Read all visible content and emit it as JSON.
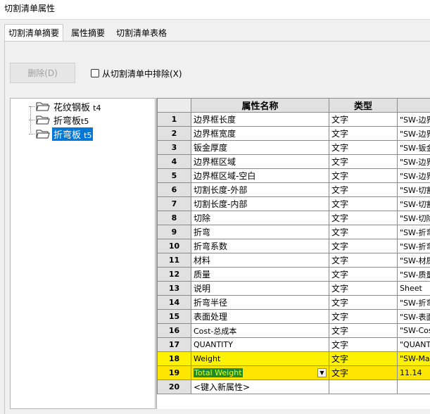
{
  "window": {
    "title": "切割清单属性"
  },
  "tabs": [
    {
      "label": "切割清单摘要",
      "active": true
    },
    {
      "label": "属性摘要",
      "active": false
    },
    {
      "label": "切割清单表格",
      "active": false
    }
  ],
  "toolbar": {
    "delete_label": "删除(D)",
    "exclude_label": "从切割清单中排除(X)",
    "exclude_checked": false
  },
  "tree": {
    "items": [
      {
        "name": "花纹钢板",
        "suffix": "t4",
        "selected": false
      },
      {
        "name": "折弯板",
        "suffix": "t5",
        "selected": false
      },
      {
        "name": "折弯板",
        "suffix": "t5",
        "selected": true
      }
    ]
  },
  "grid": {
    "headers": [
      "属性名称",
      "类型",
      ""
    ],
    "rows": [
      {
        "num": "1",
        "name": "边界框长度",
        "type": "文字",
        "value": "\"SW-边界"
      },
      {
        "num": "2",
        "name": "边界框宽度",
        "type": "文字",
        "value": "\"SW-边界"
      },
      {
        "num": "3",
        "name": "钣金厚度",
        "type": "文字",
        "value": "\"SW-钣金"
      },
      {
        "num": "4",
        "name": "边界框区域",
        "type": "文字",
        "value": "\"SW-边界"
      },
      {
        "num": "5",
        "name": "边界框区域-空白",
        "type": "文字",
        "value": "\"SW-边界"
      },
      {
        "num": "6",
        "name": "切割长度-外部",
        "type": "文字",
        "value": "\"SW-切割"
      },
      {
        "num": "7",
        "name": "切割长度-内部",
        "type": "文字",
        "value": "\"SW-切割"
      },
      {
        "num": "8",
        "name": "切除",
        "type": "文字",
        "value": "\"SW-切除"
      },
      {
        "num": "9",
        "name": "折弯",
        "type": "文字",
        "value": "\"SW-折弯"
      },
      {
        "num": "10",
        "name": "折弯系数",
        "type": "文字",
        "value": "\"SW-折弯"
      },
      {
        "num": "11",
        "name": "材料",
        "type": "文字",
        "value": "\"SW-材质"
      },
      {
        "num": "12",
        "name": "质量",
        "type": "文字",
        "value": "\"SW-质量"
      },
      {
        "num": "13",
        "name": "说明",
        "type": "文字",
        "value": "Sheet"
      },
      {
        "num": "14",
        "name": "折弯半径",
        "type": "文字",
        "value": "\"SW-折弯"
      },
      {
        "num": "15",
        "name": "表面处理",
        "type": "文字",
        "value": "\"SW-表面"
      },
      {
        "num": "16",
        "name": "Cost-总成本",
        "type": "文字",
        "value": "\"SW-Cost"
      },
      {
        "num": "17",
        "name": "QUANTITY",
        "type": "文字",
        "value": "\"QUANTIT"
      },
      {
        "num": "18",
        "name": "Weight",
        "type": "文字",
        "value": "\"SW-Mas"
      },
      {
        "num": "19",
        "name": "Total Weight",
        "type": "文字",
        "value": "11.14"
      },
      {
        "num": "20",
        "name": "<键入新属性>",
        "type": "",
        "value": ""
      }
    ]
  },
  "colors": {
    "selection": "#0078d7",
    "highlight": "#fff200",
    "edit_bg": "#1f8a2e"
  }
}
